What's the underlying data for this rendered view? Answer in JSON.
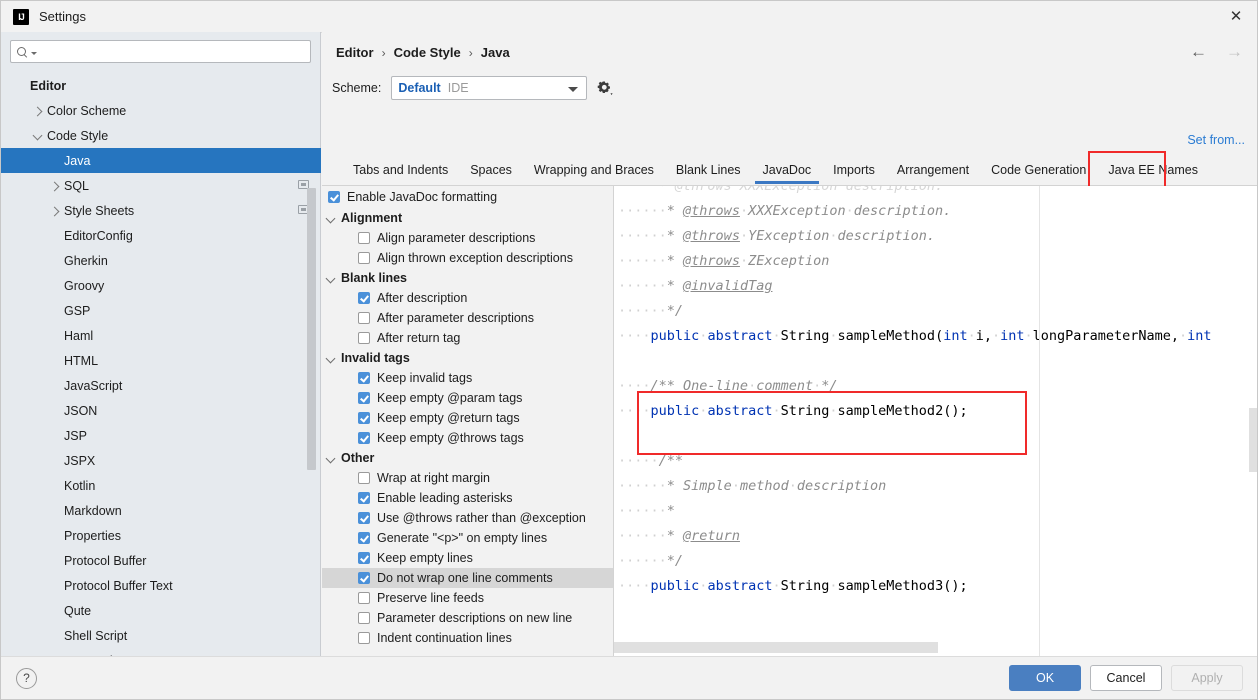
{
  "window": {
    "title": "Settings",
    "logo_text": "IJ",
    "close_icon": "✕"
  },
  "sidebar": {
    "search": {
      "placeholder": "",
      "value": "",
      "icon": "search-icon"
    },
    "items": [
      {
        "label": "Editor",
        "indent": 0,
        "chevron": "none",
        "bold": true,
        "selected": false,
        "badge": false
      },
      {
        "label": "Color Scheme",
        "indent": 1,
        "chevron": "right",
        "bold": false,
        "selected": false,
        "badge": false
      },
      {
        "label": "Code Style",
        "indent": 1,
        "chevron": "down",
        "bold": false,
        "selected": false,
        "badge": false
      },
      {
        "label": "Java",
        "indent": 2,
        "chevron": "none",
        "bold": false,
        "selected": true,
        "badge": false
      },
      {
        "label": "SQL",
        "indent": 2,
        "chevron": "right",
        "bold": false,
        "selected": false,
        "badge": true
      },
      {
        "label": "Style Sheets",
        "indent": 2,
        "chevron": "right",
        "bold": false,
        "selected": false,
        "badge": true
      },
      {
        "label": "EditorConfig",
        "indent": 2,
        "chevron": "none",
        "bold": false,
        "selected": false,
        "badge": false
      },
      {
        "label": "Gherkin",
        "indent": 2,
        "chevron": "none",
        "bold": false,
        "selected": false,
        "badge": false
      },
      {
        "label": "Groovy",
        "indent": 2,
        "chevron": "none",
        "bold": false,
        "selected": false,
        "badge": false
      },
      {
        "label": "GSP",
        "indent": 2,
        "chevron": "none",
        "bold": false,
        "selected": false,
        "badge": false
      },
      {
        "label": "Haml",
        "indent": 2,
        "chevron": "none",
        "bold": false,
        "selected": false,
        "badge": false
      },
      {
        "label": "HTML",
        "indent": 2,
        "chevron": "none",
        "bold": false,
        "selected": false,
        "badge": false
      },
      {
        "label": "JavaScript",
        "indent": 2,
        "chevron": "none",
        "bold": false,
        "selected": false,
        "badge": false
      },
      {
        "label": "JSON",
        "indent": 2,
        "chevron": "none",
        "bold": false,
        "selected": false,
        "badge": false
      },
      {
        "label": "JSP",
        "indent": 2,
        "chevron": "none",
        "bold": false,
        "selected": false,
        "badge": false
      },
      {
        "label": "JSPX",
        "indent": 2,
        "chevron": "none",
        "bold": false,
        "selected": false,
        "badge": false
      },
      {
        "label": "Kotlin",
        "indent": 2,
        "chevron": "none",
        "bold": false,
        "selected": false,
        "badge": false
      },
      {
        "label": "Markdown",
        "indent": 2,
        "chevron": "none",
        "bold": false,
        "selected": false,
        "badge": false
      },
      {
        "label": "Properties",
        "indent": 2,
        "chevron": "none",
        "bold": false,
        "selected": false,
        "badge": false
      },
      {
        "label": "Protocol Buffer",
        "indent": 2,
        "chevron": "none",
        "bold": false,
        "selected": false,
        "badge": false
      },
      {
        "label": "Protocol Buffer Text",
        "indent": 2,
        "chevron": "none",
        "bold": false,
        "selected": false,
        "badge": false
      },
      {
        "label": "Qute",
        "indent": 2,
        "chevron": "none",
        "bold": false,
        "selected": false,
        "badge": false
      },
      {
        "label": "Shell Script",
        "indent": 2,
        "chevron": "none",
        "bold": false,
        "selected": false,
        "badge": false
      },
      {
        "label": "TypeScript",
        "indent": 2,
        "chevron": "none",
        "bold": false,
        "selected": false,
        "badge": false
      }
    ]
  },
  "header": {
    "breadcrumb": [
      "Editor",
      "Code Style",
      "Java"
    ],
    "separator": "›",
    "back_arrow": "←",
    "forward_arrow": "→",
    "scheme_label": "Scheme:",
    "scheme_value": "Default",
    "scheme_scope": "IDE",
    "gear_icon": "gear-icon",
    "set_from_link": "Set from..."
  },
  "tabs": {
    "items": [
      {
        "label": "Tabs and Indents",
        "active": false
      },
      {
        "label": "Spaces",
        "active": false
      },
      {
        "label": "Wrapping and Braces",
        "active": false
      },
      {
        "label": "Blank Lines",
        "active": false
      },
      {
        "label": "JavaDoc",
        "active": true
      },
      {
        "label": "Imports",
        "active": false
      },
      {
        "label": "Arrangement",
        "active": false
      },
      {
        "label": "Code Generation",
        "active": false
      },
      {
        "label": "Java EE Names",
        "active": false
      }
    ],
    "highlight_color": "#f02a2a"
  },
  "options": {
    "enable_formatting": {
      "label": "Enable JavaDoc formatting",
      "checked": true
    },
    "groups": [
      {
        "title": "Alignment",
        "expanded": true,
        "items": [
          {
            "label": "Align parameter descriptions",
            "checked": false,
            "highlighted": false
          },
          {
            "label": "Align thrown exception descriptions",
            "checked": false,
            "highlighted": false
          }
        ]
      },
      {
        "title": "Blank lines",
        "expanded": true,
        "items": [
          {
            "label": "After description",
            "checked": true,
            "highlighted": false
          },
          {
            "label": "After parameter descriptions",
            "checked": false,
            "highlighted": false
          },
          {
            "label": "After return tag",
            "checked": false,
            "highlighted": false
          }
        ]
      },
      {
        "title": "Invalid tags",
        "expanded": true,
        "items": [
          {
            "label": "Keep invalid tags",
            "checked": true,
            "highlighted": false
          },
          {
            "label": "Keep empty @param tags",
            "checked": true,
            "highlighted": false
          },
          {
            "label": "Keep empty @return tags",
            "checked": true,
            "highlighted": false
          },
          {
            "label": "Keep empty @throws tags",
            "checked": true,
            "highlighted": false
          }
        ]
      },
      {
        "title": "Other",
        "expanded": true,
        "items": [
          {
            "label": "Wrap at right margin",
            "checked": false,
            "highlighted": false
          },
          {
            "label": "Enable leading asterisks",
            "checked": true,
            "highlighted": false
          },
          {
            "label": "Use @throws rather than @exception",
            "checked": true,
            "highlighted": false
          },
          {
            "label": "Generate \"<p>\" on empty lines",
            "checked": true,
            "highlighted": false
          },
          {
            "label": "Keep empty lines",
            "checked": true,
            "highlighted": false
          },
          {
            "label": "Do not wrap one line comments",
            "checked": true,
            "highlighted": true
          },
          {
            "label": "Preserve line feeds",
            "checked": false,
            "highlighted": false
          },
          {
            "label": "Parameter descriptions on new line",
            "checked": false,
            "highlighted": false
          },
          {
            "label": "Indent continuation lines",
            "checked": false,
            "highlighted": false
          }
        ]
      }
    ]
  },
  "preview": {
    "lines": [
      [
        {
          "t": "     * @throws XXXException description.",
          "c": "partial"
        }
      ],
      [
        {
          "t": "······",
          "c": "dot"
        },
        {
          "t": "* ",
          "c": "jd"
        },
        {
          "t": "@throws",
          "c": "tag"
        },
        {
          "t": "·",
          "c": "dot"
        },
        {
          "t": "XXXException",
          "c": "jd"
        },
        {
          "t": "·",
          "c": "dot"
        },
        {
          "t": "description.",
          "c": "jd"
        }
      ],
      [
        {
          "t": "······",
          "c": "dot"
        },
        {
          "t": "* ",
          "c": "jd"
        },
        {
          "t": "@throws",
          "c": "tag"
        },
        {
          "t": "·",
          "c": "dot"
        },
        {
          "t": "YException",
          "c": "jd"
        },
        {
          "t": "·",
          "c": "dot"
        },
        {
          "t": "description.",
          "c": "jd"
        }
      ],
      [
        {
          "t": "······",
          "c": "dot"
        },
        {
          "t": "* ",
          "c": "jd"
        },
        {
          "t": "@throws",
          "c": "tag"
        },
        {
          "t": "·",
          "c": "dot"
        },
        {
          "t": "ZException",
          "c": "jd"
        }
      ],
      [
        {
          "t": "······",
          "c": "dot"
        },
        {
          "t": "* ",
          "c": "jd"
        },
        {
          "t": "@invalidTag",
          "c": "tag"
        }
      ],
      [
        {
          "t": "······",
          "c": "dot"
        },
        {
          "t": "*/",
          "c": "jd"
        }
      ],
      [
        {
          "t": "····",
          "c": "dot"
        },
        {
          "t": "public",
          "c": "kw"
        },
        {
          "t": "·",
          "c": "dot"
        },
        {
          "t": "abstract",
          "c": "kw"
        },
        {
          "t": "·",
          "c": "dot"
        },
        {
          "t": "String",
          "c": "pl"
        },
        {
          "t": "·",
          "c": "dot"
        },
        {
          "t": "sampleMethod(",
          "c": "pl"
        },
        {
          "t": "int",
          "c": "kw"
        },
        {
          "t": "·",
          "c": "dot"
        },
        {
          "t": "i,",
          "c": "pl"
        },
        {
          "t": "·",
          "c": "dot"
        },
        {
          "t": "int",
          "c": "kw"
        },
        {
          "t": "·",
          "c": "dot"
        },
        {
          "t": "longParameterName,",
          "c": "pl"
        },
        {
          "t": "·",
          "c": "dot"
        },
        {
          "t": "int",
          "c": "kw"
        }
      ],
      [],
      [
        {
          "t": "····",
          "c": "dot"
        },
        {
          "t": "/** ",
          "c": "jd"
        },
        {
          "t": "One-line",
          "c": "jd"
        },
        {
          "t": "·",
          "c": "dot"
        },
        {
          "t": "comment",
          "c": "jd"
        },
        {
          "t": "·",
          "c": "dot"
        },
        {
          "t": "*/",
          "c": "jd"
        }
      ],
      [
        {
          "t": "····",
          "c": "dot"
        },
        {
          "t": "public",
          "c": "kw"
        },
        {
          "t": "·",
          "c": "dot"
        },
        {
          "t": "abstract",
          "c": "kw"
        },
        {
          "t": "·",
          "c": "dot"
        },
        {
          "t": "String",
          "c": "pl"
        },
        {
          "t": "·",
          "c": "dot"
        },
        {
          "t": "sampleMethod2();",
          "c": "pl"
        }
      ],
      [],
      [
        {
          "t": "·····",
          "c": "dot"
        },
        {
          "t": "/**",
          "c": "jd"
        }
      ],
      [
        {
          "t": "······",
          "c": "dot"
        },
        {
          "t": "* ",
          "c": "jd"
        },
        {
          "t": "Simple",
          "c": "jd"
        },
        {
          "t": "·",
          "c": "dot"
        },
        {
          "t": "method",
          "c": "jd"
        },
        {
          "t": "·",
          "c": "dot"
        },
        {
          "t": "description",
          "c": "jd"
        }
      ],
      [
        {
          "t": "······",
          "c": "dot"
        },
        {
          "t": "*",
          "c": "jd"
        }
      ],
      [
        {
          "t": "······",
          "c": "dot"
        },
        {
          "t": "* ",
          "c": "jd"
        },
        {
          "t": "@return",
          "c": "tag"
        }
      ],
      [
        {
          "t": "······",
          "c": "dot"
        },
        {
          "t": "*/",
          "c": "jd"
        }
      ],
      [
        {
          "t": "····",
          "c": "dot"
        },
        {
          "t": "public",
          "c": "kw"
        },
        {
          "t": "·",
          "c": "dot"
        },
        {
          "t": "abstract",
          "c": "kw"
        },
        {
          "t": "·",
          "c": "dot"
        },
        {
          "t": "String",
          "c": "pl"
        },
        {
          "t": "·",
          "c": "dot"
        },
        {
          "t": "sampleMethod3();",
          "c": "pl"
        }
      ]
    ],
    "highlight_color": "#f02a2a"
  },
  "footer": {
    "help_label": "?",
    "ok_label": "OK",
    "cancel_label": "Cancel",
    "apply_label": "Apply",
    "apply_disabled": true,
    "primary_color": "#4a7fc1"
  }
}
